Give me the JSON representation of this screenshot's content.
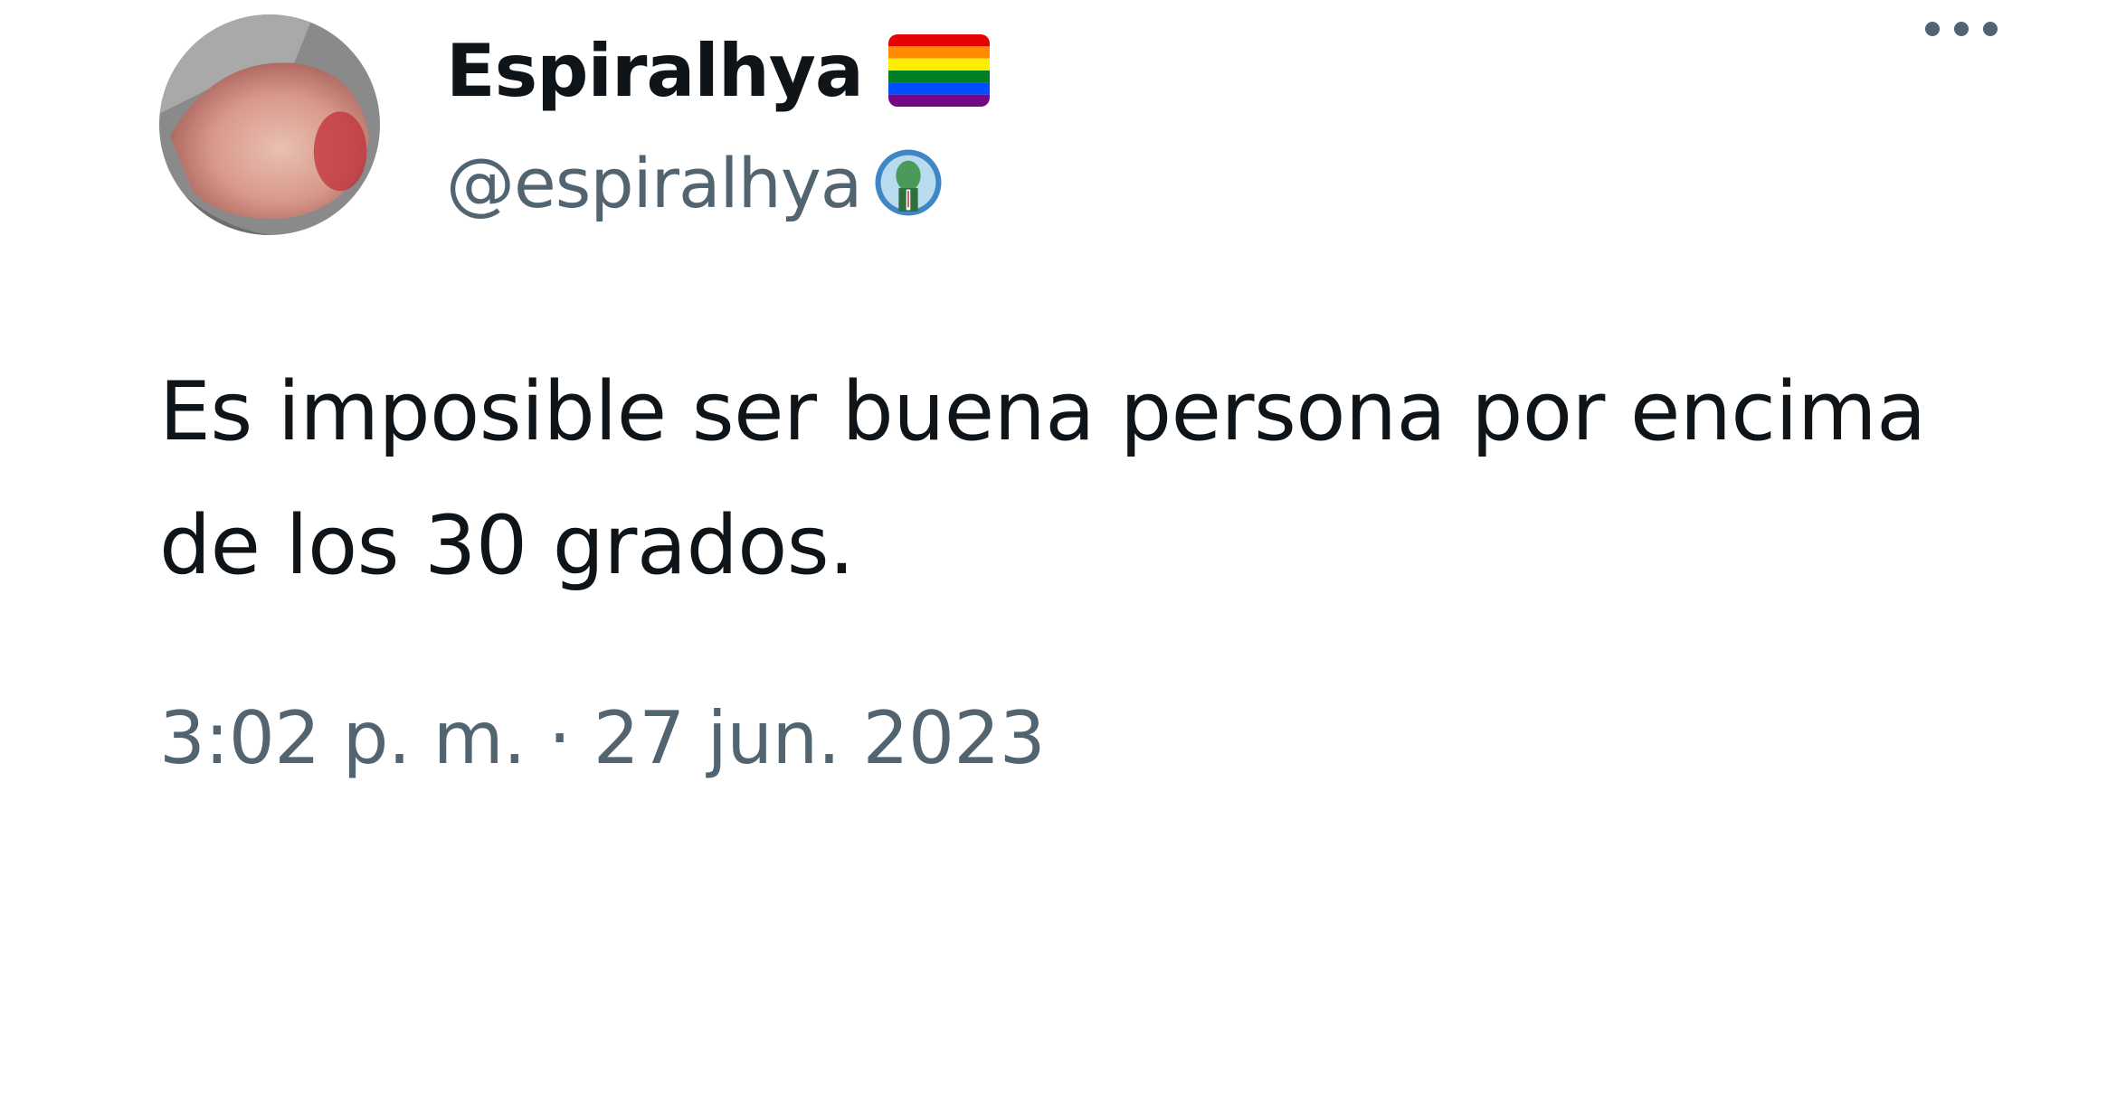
{
  "author": {
    "display_name": "Espiralhya",
    "name_emoji": "rainbow-flag-icon",
    "handle": "@espiralhya",
    "handle_badge": "globe-avatar-badge-icon"
  },
  "tweet": {
    "text_lines": [
      "Es imposible ser buena persona por encima",
      "de los 30 grados."
    ],
    "timestamp": "3:02 p. m. · 27 jun. 2023"
  },
  "header": {
    "more_icon": "more-options-icon"
  },
  "colors": {
    "text_primary": "#0f1419",
    "text_secondary": "#536471",
    "background": "#ffffff"
  }
}
